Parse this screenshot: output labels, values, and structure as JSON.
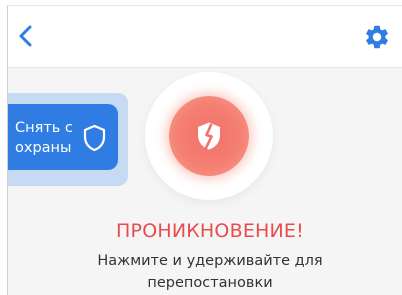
{
  "header": {
    "back_icon": "chevron-left-icon",
    "settings_icon": "gear-icon"
  },
  "disarm_button": {
    "label": "Снять с\nохраны",
    "icon": "shield-icon"
  },
  "alarm": {
    "icon": "broken-shield-icon",
    "title": "ПРОНИКНОВЕНИЕ!",
    "hint_line1": "Нажмите и удерживайте для",
    "hint_line2": "перепостановки"
  },
  "colors": {
    "accent_blue": "#2f7de3",
    "alarm_red": "#e94c4c",
    "alarm_circle": "#f47f72"
  }
}
